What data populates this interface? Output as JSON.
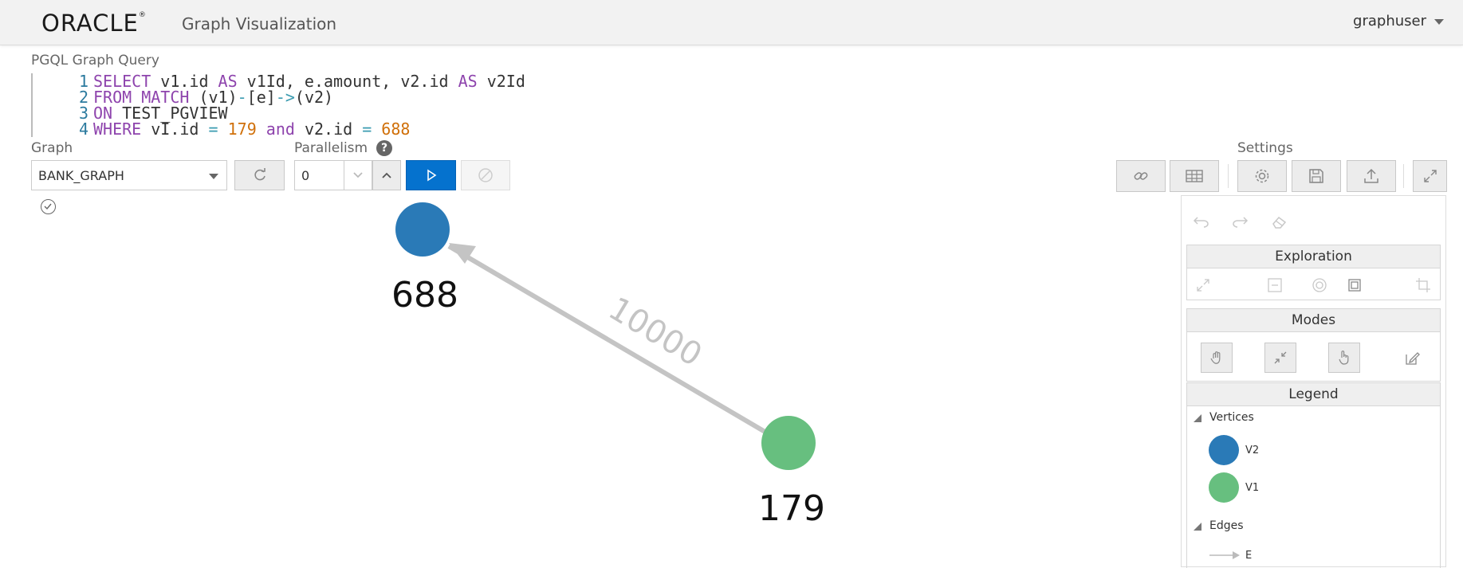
{
  "header": {
    "logo_text": "ORACLE",
    "logo_reg": "®",
    "app_title": "Graph Visualization",
    "user": "graphuser"
  },
  "query": {
    "label": "PGQL Graph Query",
    "lines": [
      {
        "num": "1",
        "tokens": [
          [
            "kw",
            "SELECT"
          ],
          [
            "plain",
            " v1.id "
          ],
          [
            "kw",
            "AS"
          ],
          [
            "plain",
            " v1Id, e.amount, v2.id "
          ],
          [
            "kw",
            "AS"
          ],
          [
            "plain",
            " v2Id"
          ]
        ]
      },
      {
        "num": "2",
        "tokens": [
          [
            "kw",
            "FROM"
          ],
          [
            "plain",
            " "
          ],
          [
            "kw",
            "MATCH"
          ],
          [
            "plain",
            " (v1)"
          ],
          [
            "op",
            "-"
          ],
          [
            "plain",
            "[e]"
          ],
          [
            "op",
            "->"
          ],
          [
            "plain",
            "(v2)"
          ]
        ]
      },
      {
        "num": "3",
        "tokens": [
          [
            "kw",
            "ON"
          ],
          [
            "plain",
            " TEST_PGVIEW"
          ]
        ]
      },
      {
        "num": "4",
        "tokens": [
          [
            "kw",
            "WHERE"
          ],
          [
            "plain",
            " vI.id "
          ],
          [
            "op",
            "="
          ],
          [
            "plain",
            " "
          ],
          [
            "num",
            "179"
          ],
          [
            "plain",
            " "
          ],
          [
            "kw",
            "and"
          ],
          [
            "plain",
            " v2.id "
          ],
          [
            "op",
            "="
          ],
          [
            "plain",
            " "
          ],
          [
            "num",
            "688"
          ]
        ]
      }
    ]
  },
  "controls": {
    "graph_label": "Graph",
    "graph_value": "BANK_GRAPH",
    "parallelism_label": "Parallelism",
    "parallelism_value": "0",
    "settings_label": "Settings"
  },
  "graph": {
    "nodes": [
      {
        "id": "688",
        "color": "#2a7ab7",
        "type": "V2"
      },
      {
        "id": "179",
        "color": "#67bf7f",
        "type": "V1"
      }
    ],
    "edges": [
      {
        "source": "179",
        "target": "688",
        "label": "10000",
        "color": "#c4c4c4"
      }
    ]
  },
  "panel": {
    "exploration": "Exploration",
    "modes": "Modes",
    "legend": "Legend",
    "vertices_label": "Vertices",
    "edges_label": "Edges",
    "legend_vertices": [
      {
        "name": "V2",
        "color": "#2a7ab7"
      },
      {
        "name": "V1",
        "color": "#67bf7f"
      }
    ],
    "legend_edges": [
      {
        "name": "E"
      }
    ]
  },
  "colors": {
    "accent": "#0572ce",
    "v2": "#2a7ab7",
    "v1": "#67bf7f",
    "edge": "#c4c4c4"
  }
}
